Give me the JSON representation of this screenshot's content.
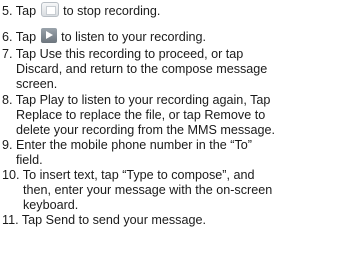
{
  "steps": [
    {
      "number": "5.",
      "before_icon": "Tap",
      "icon": "stop-icon",
      "after_icon": "to stop recording."
    },
    {
      "number": "6.",
      "before_icon": "Tap",
      "icon": "play-icon",
      "after_icon": "to listen to your recording."
    },
    {
      "number": "7.",
      "lines": [
        "Tap Use this recording to proceed, or tap",
        "Discard, and return to the compose message",
        "screen."
      ]
    },
    {
      "number": "8.",
      "lines": [
        "Tap Play to listen to your recording again, Tap",
        "Replace to replace the file, or tap Remove to",
        "delete your recording from the MMS message."
      ]
    },
    {
      "number": "9.",
      "lines": [
        "Enter the mobile phone number in the “To”",
        "field."
      ]
    },
    {
      "number": "10.",
      "lines": [
        "To insert text, tap “Type to compose”, and",
        "then, enter your message with the on-screen",
        "keyboard."
      ]
    },
    {
      "number": "11.",
      "lines": [
        "Tap Send to send your message."
      ]
    }
  ]
}
